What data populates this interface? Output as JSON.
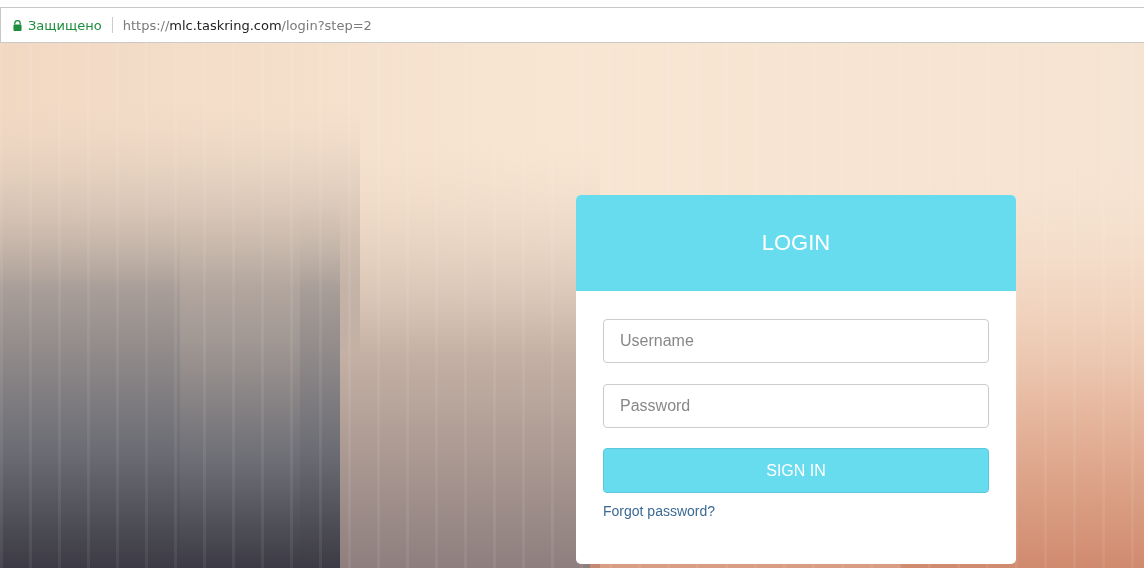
{
  "address_bar": {
    "security_label": "Защищено",
    "url": {
      "scheme": "https://",
      "host": "mlc.taskring.com",
      "path": "/login?step=2"
    }
  },
  "login_card": {
    "title": "LOGIN",
    "fields": [
      {
        "placeholder": "Username"
      },
      {
        "placeholder": "Password"
      }
    ],
    "submit_button": "SIGN IN",
    "forgot_link": "Forgot password?"
  }
}
